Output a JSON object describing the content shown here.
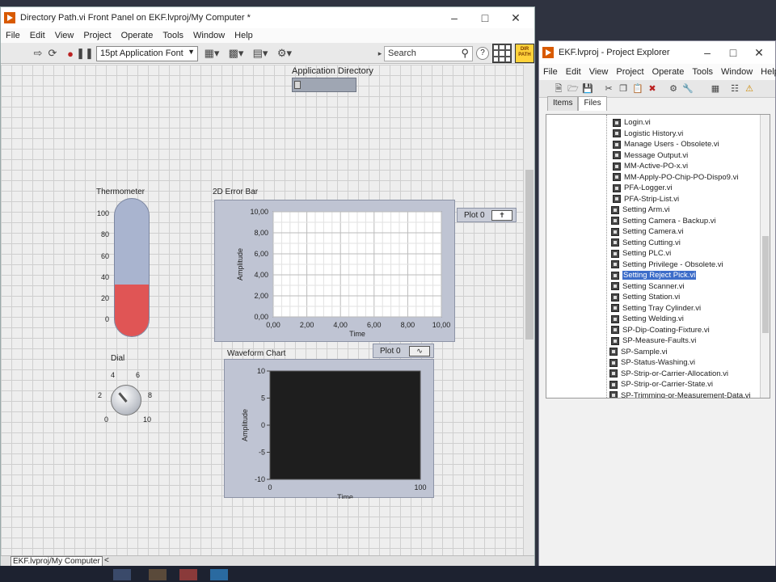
{
  "main_window": {
    "title": "Directory Path.vi Front Panel on EKF.lvproj/My Computer *",
    "menu": [
      "File",
      "Edit",
      "View",
      "Project",
      "Operate",
      "Tools",
      "Window",
      "Help"
    ],
    "font_selector": "15pt Application Font",
    "search_placeholder": "Search",
    "help_glyph": "?",
    "vi_icon_text": "DIR PATH",
    "status_path": "EKF.lvproj/My Computer",
    "status_arrow": "<"
  },
  "front_panel": {
    "app_dir_label": "Application Directory",
    "thermometer": {
      "label": "Thermometer",
      "ticks": [
        "100",
        "80",
        "60",
        "40",
        "20",
        "0"
      ],
      "value_percent": 20
    },
    "dial": {
      "label": "Dial",
      "ticks": [
        "0",
        "2",
        "4",
        "6",
        "8",
        "10"
      ]
    },
    "error_bar_graph": {
      "label": "2D Error Bar",
      "legend": "Plot 0"
    },
    "waveform_chart": {
      "label": "Waveform Chart",
      "legend": "Plot 0"
    }
  },
  "chart_data": [
    {
      "type": "scatter",
      "title": "2D Error Bar",
      "xlabel": "Time",
      "ylabel": "Amplitude",
      "xlim": [
        0,
        10
      ],
      "ylim": [
        0,
        10
      ],
      "x_ticks": [
        "0,00",
        "2,00",
        "4,00",
        "6,00",
        "8,00",
        "10,00"
      ],
      "y_ticks": [
        "0,00",
        "2,00",
        "4,00",
        "6,00",
        "8,00",
        "10,00"
      ],
      "grid": true,
      "series": []
    },
    {
      "type": "line",
      "title": "Waveform Chart",
      "xlabel": "Time",
      "ylabel": "Amplitude",
      "xlim": [
        0,
        100
      ],
      "ylim": [
        -10,
        10
      ],
      "x_ticks": [
        "0",
        "100"
      ],
      "y_ticks": [
        "10",
        "5",
        "0",
        "-5",
        "-10"
      ],
      "grid": false,
      "plot_background": "#1e1e1e",
      "series": []
    }
  ],
  "project_window": {
    "title": "EKF.lvproj - Project Explorer",
    "menu": [
      "File",
      "Edit",
      "View",
      "Project",
      "Operate",
      "Tools",
      "Window",
      "Help"
    ],
    "tabs": [
      "Items",
      "Files"
    ],
    "active_tab": "Files",
    "files": [
      "Login.vi",
      "Logistic History.vi",
      "Manage Users - Obsolete.vi",
      "Message Output.vi",
      "MM-Active-PO-x.vi",
      "MM-Apply-PO-Chip-PO-Dispo9.vi",
      "PFA-Logger.vi",
      "PFA-Strip-List.vi",
      "Setting Arm.vi",
      "Setting Camera - Backup.vi",
      "Setting Camera.vi",
      "Setting Cutting.vi",
      "Setting PLC.vi",
      "Setting Privilege - Obsolete.vi",
      "Setting Reject Pick.vi",
      "Setting Scanner.vi",
      "Setting Station.vi",
      "Setting Tray Cylinder.vi",
      "Setting Welding.vi",
      "SP-Dip-Coating-Fixture.vi",
      "SP-Measure-Faults.vi",
      "SP-Sample.vi",
      "SP-Status-Washing.vi",
      "SP-Strip-or-Carrier-Allocation.vi",
      "SP-Strip-or-Carrier-State.vi",
      "SP-Trimming-or-Measurement-Data.vi"
    ],
    "selected_file": "Setting Reject Pick.vi"
  },
  "colors": {
    "thermo_fill": "#e05555",
    "selection": "#3d6dc9",
    "labview_accent": "#d85a00"
  }
}
